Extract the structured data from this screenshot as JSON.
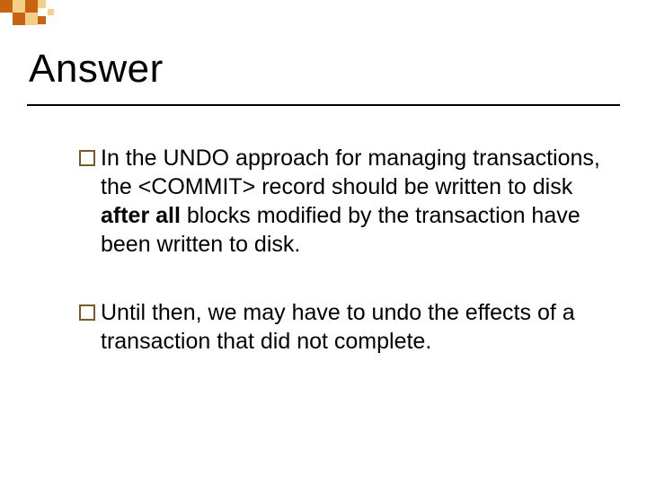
{
  "title": "Answer",
  "bullets": [
    {
      "lead": "In",
      "before_bold": " the UNDO approach for managing transactions,  the <COMMIT> record should be written to disk ",
      "bold": "after all",
      "after_bold": " blocks modified by the transaction have been written to disk."
    },
    {
      "lead": "Until",
      "before_bold": " then, we may have to undo the effects of a transaction that did not complete.",
      "bold": "",
      "after_bold": ""
    }
  ],
  "deco_colors": {
    "dark": "#c8640f",
    "light": "#f4cf89"
  }
}
